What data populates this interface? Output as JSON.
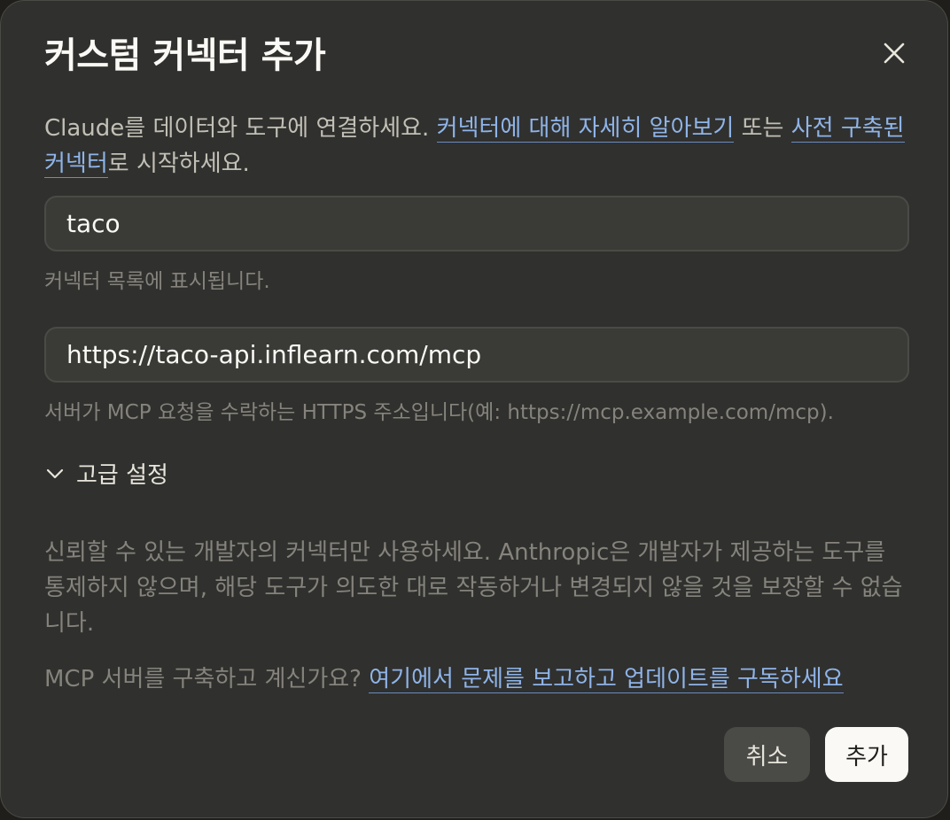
{
  "dialog": {
    "title": "커스텀 커넥터 추가",
    "close_icon": "close-icon"
  },
  "intro": {
    "text_1": "Claude를 데이터와 도구에 연결하세요. ",
    "link_learn_more": "커넥터에 대해 자세히 알아보기",
    "text_2": " 또는 ",
    "link_prebuilt": "사전 구축된 커넥터",
    "text_3": "로 시작하세요."
  },
  "name_field": {
    "value": "taco",
    "hint": "커넥터 목록에 표시됩니다."
  },
  "url_field": {
    "value": "https://taco-api.inflearn.com/mcp",
    "hint": "서버가 MCP 요청을 수락하는 HTTPS 주소입니다(예: https://mcp.example.com/mcp)."
  },
  "advanced": {
    "label": "고급 설정",
    "icon": "chevron-down-icon"
  },
  "warning": {
    "text": "신뢰할 수 있는 개발자의 커넥터만 사용하세요. Anthropic은 개발자가 제공하는 도구를 통제하지 않으며, 해당 도구가 의도한 대로 작동하거나 변경되지 않을 것을 보장할 수 없습니다."
  },
  "mcp_help": {
    "text": "MCP 서버를 구축하고 계신가요? ",
    "link": "여기에서 문제를 보고하고 업데이트를 구독하세요"
  },
  "buttons": {
    "cancel": "취소",
    "add": "추가"
  },
  "colors": {
    "dialog_bg": "#30302e",
    "link": "#8fb4e8",
    "primary_button_bg": "#faf9f5"
  }
}
